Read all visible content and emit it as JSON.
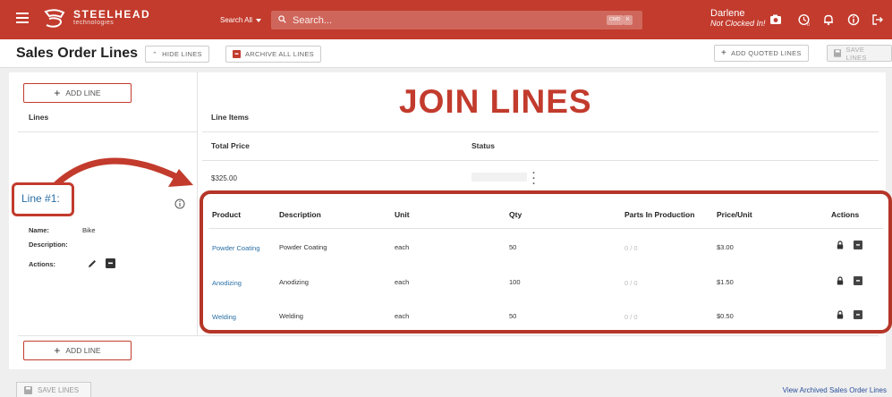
{
  "topbar": {
    "brand_line1": "STEELHEAD",
    "brand_line2": "technologies",
    "search_scope": "Search All",
    "search_placeholder": "Search...",
    "kbd_cmd": "CMD",
    "kbd_k": "K",
    "user_name": "Darlene",
    "user_status": "Not Clocked In!",
    "accent": "#c23b2d"
  },
  "header": {
    "title": "Sales Order Lines",
    "hide_lines": "HIDE LINES",
    "archive_all": "ARCHIVE ALL LINES",
    "add_quoted": "ADD QUOTED LINES",
    "save_lines": "SAVE LINES"
  },
  "overlay": {
    "title": "JOIN LINES"
  },
  "left": {
    "add_line": "ADD LINE",
    "lines_header": "Lines",
    "line_label": "Line #1:",
    "name_label": "Name:",
    "name_value": "Bike",
    "description_label": "Description:",
    "actions_label": "Actions:"
  },
  "summary": {
    "line_items_header": "Line Items",
    "total_price_header": "Total Price",
    "status_header": "Status",
    "total_price_value": "$325.00"
  },
  "table": {
    "columns": [
      "Product",
      "Description",
      "Unit",
      "Qty",
      "Parts In Production",
      "Price/Unit",
      "Actions"
    ],
    "rows": [
      {
        "product": "Powder Coating",
        "description": "Powder Coating",
        "unit": "each",
        "qty": "50",
        "parts": "0 / 0",
        "price": "$3.00"
      },
      {
        "product": "Anodizing",
        "description": "Anodizing",
        "unit": "each",
        "qty": "100",
        "parts": "0 / 0",
        "price": "$1.50"
      },
      {
        "product": "Welding",
        "description": "Welding",
        "unit": "each",
        "qty": "50",
        "parts": "0 / 0",
        "price": "$0.50"
      }
    ]
  },
  "footer": {
    "save_lines": "SAVE LINES",
    "view_archived": "View Archived Sales Order Lines"
  }
}
